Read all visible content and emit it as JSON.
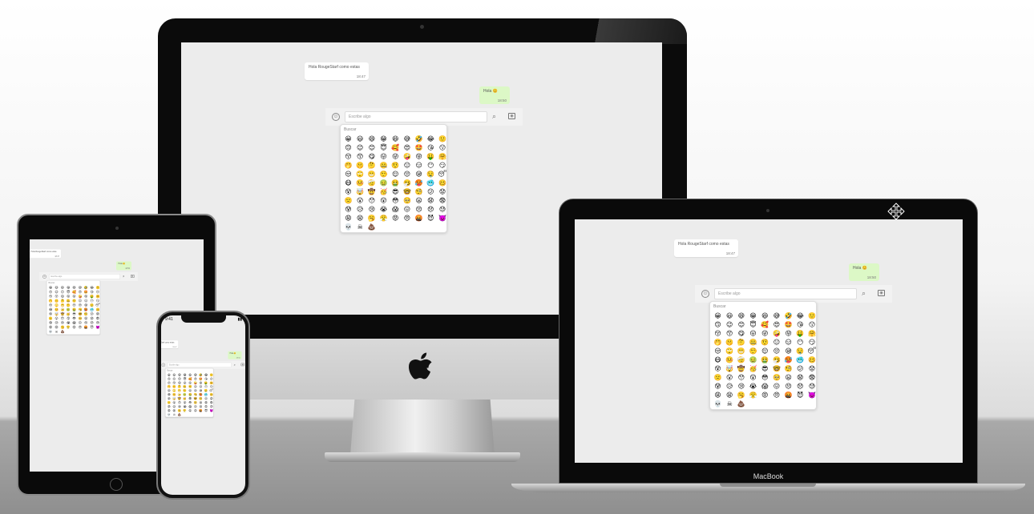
{
  "chat": {
    "incoming_message": "Hola RougeStarf como estas",
    "incoming_time": "18:47",
    "outgoing_message": "Hola 😊",
    "outgoing_time": "18:50",
    "input_placeholder": "Escribe algo",
    "emoji_search_placeholder": "Buscar"
  },
  "emojis": [
    "😀",
    "😃",
    "😄",
    "😁",
    "😆",
    "😅",
    "🤣",
    "😂",
    "🙂",
    "🙃",
    "😉",
    "😊",
    "😇",
    "🥰",
    "😍",
    "🤩",
    "😘",
    "😗",
    "😚",
    "😙",
    "😋",
    "😛",
    "😜",
    "🤪",
    "😝",
    "🤑",
    "🤗",
    "🤭",
    "🤫",
    "🤔",
    "🤐",
    "🤨",
    "😐",
    "😑",
    "😶",
    "😏",
    "😒",
    "🙄",
    "😬",
    "🤥",
    "😌",
    "😔",
    "😪",
    "🤤",
    "😴",
    "😷",
    "🤒",
    "🤕",
    "🤢",
    "🤮",
    "🤧",
    "🥵",
    "🥶",
    "🥴",
    "😵",
    "🤯",
    "🤠",
    "🥳",
    "😎",
    "🤓",
    "🧐",
    "😕",
    "😟",
    "🙁",
    "😮",
    "😯",
    "😲",
    "😳",
    "🥺",
    "😦",
    "😧",
    "😨",
    "😰",
    "😥",
    "😢",
    "😭",
    "😱",
    "😖",
    "😣",
    "😞",
    "😓",
    "😩",
    "😫",
    "🥱",
    "😤",
    "😡",
    "😠",
    "🤬",
    "😈",
    "👿",
    "💀",
    "☠",
    "💩"
  ],
  "phone": {
    "time": "9:41"
  },
  "macbook": {
    "label": "MacBook"
  },
  "colors": {
    "chat_bg": "#ececec",
    "outgoing_bubble": "#dcf8c6",
    "incoming_bubble": "#ffffff"
  }
}
